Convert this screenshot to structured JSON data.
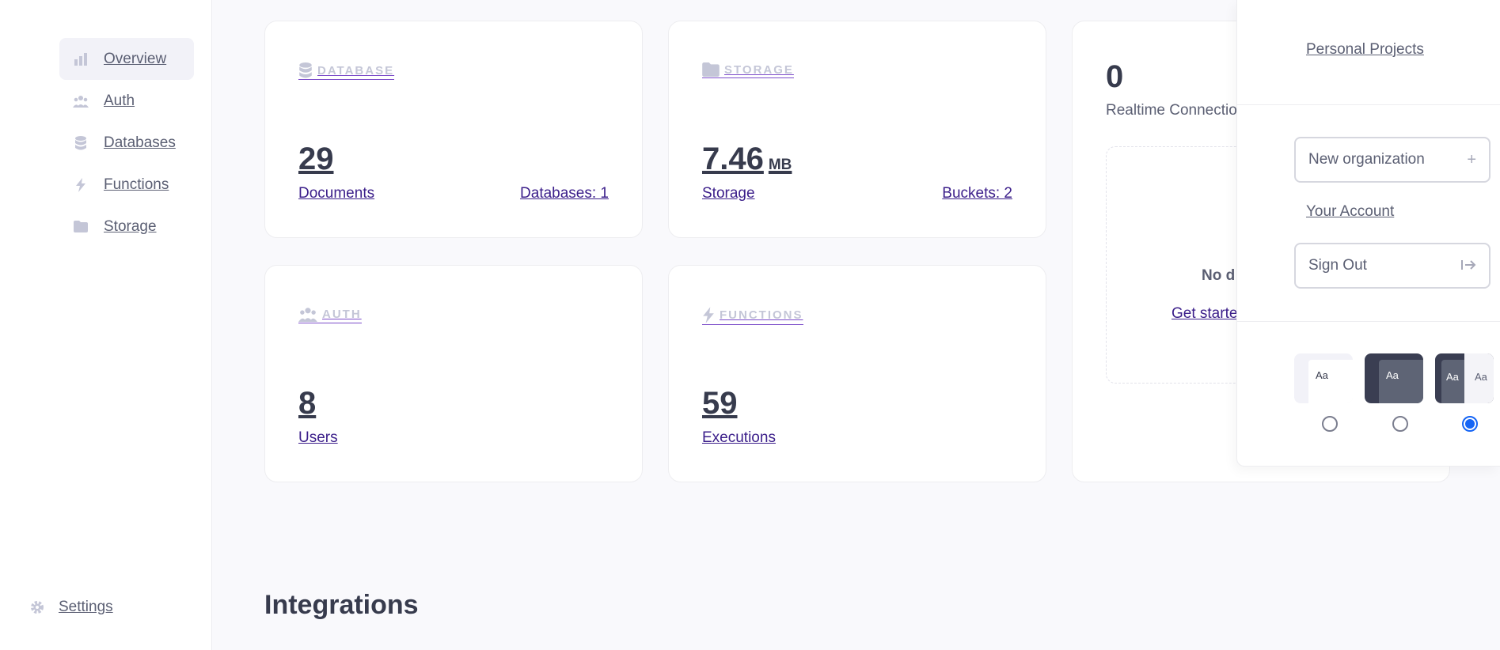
{
  "sidebar": {
    "items": [
      {
        "label": "Overview",
        "icon": "bar-chart-icon"
      },
      {
        "label": "Auth",
        "icon": "users-icon"
      },
      {
        "label": "Databases",
        "icon": "database-icon"
      },
      {
        "label": "Functions",
        "icon": "lightning-icon"
      },
      {
        "label": "Storage",
        "icon": "folder-icon"
      }
    ],
    "settings_label": "Settings"
  },
  "cards": {
    "database": {
      "heading": "DATABASE",
      "value": "29",
      "value_label": "Documents",
      "secondary": "Databases: 1"
    },
    "storage": {
      "heading": "STORAGE",
      "value": "7.46",
      "unit": "MB",
      "value_label": "Storage",
      "secondary": "Buckets: 2"
    },
    "auth": {
      "heading": "AUTH",
      "value": "8",
      "value_label": "Users"
    },
    "functions": {
      "heading": "FUNCTIONS",
      "value": "59",
      "value_label": "Executions"
    },
    "realtime": {
      "value": "0",
      "label": "Realtime Connections",
      "empty_title": "No d",
      "empty_link": "Get starte"
    }
  },
  "integrations_heading": "Integrations",
  "dropdown": {
    "org_name": "Personal Projects",
    "new_org_label": "New organization",
    "account_label": "Your Account",
    "sign_out_label": "Sign Out",
    "themes": [
      {
        "name": "light",
        "label": "Aa",
        "selected": false
      },
      {
        "name": "dark",
        "label": "Aa",
        "selected": false
      },
      {
        "name": "system",
        "label": "Aa",
        "label2": "Aa",
        "selected": true
      }
    ]
  },
  "colors": {
    "accent": "#3b1e8a",
    "radio_selected": "#1565f5",
    "muted_icon": "#c4c6d7"
  }
}
